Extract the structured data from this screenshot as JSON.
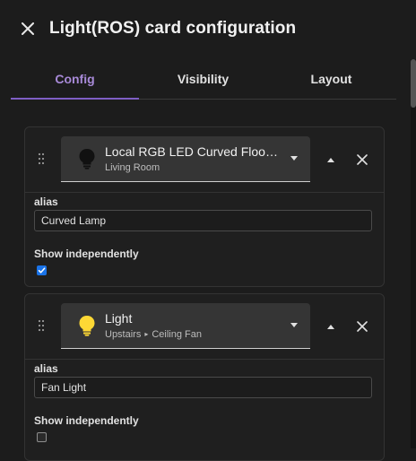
{
  "dialog": {
    "title": "Light(ROS) card configuration",
    "close_icon": "close-icon"
  },
  "tabs": [
    {
      "label": "Config",
      "active": true
    },
    {
      "label": "Visibility",
      "active": false
    },
    {
      "label": "Layout",
      "active": false
    }
  ],
  "colors": {
    "accent": "#7f5fc4",
    "checkbox_checked": "#1a73e8",
    "bulb_on": "#fdd835",
    "bulb_off": "#111111"
  },
  "entities": [
    {
      "name": "Local RGB LED Curved Floor La...",
      "area": "Living Room",
      "icon": "lightbulb-off-icon",
      "alias_label": "alias",
      "alias_value": "Curved Lamp",
      "show_label": "Show independently",
      "show_independently": true
    },
    {
      "name": "Light",
      "area_parent": "Upstairs",
      "area_separator": "▸",
      "area": "Ceiling Fan",
      "icon": "lightbulb-on-icon",
      "alias_label": "alias",
      "alias_value": "Fan Light",
      "show_label": "Show independently",
      "show_independently": false
    }
  ]
}
